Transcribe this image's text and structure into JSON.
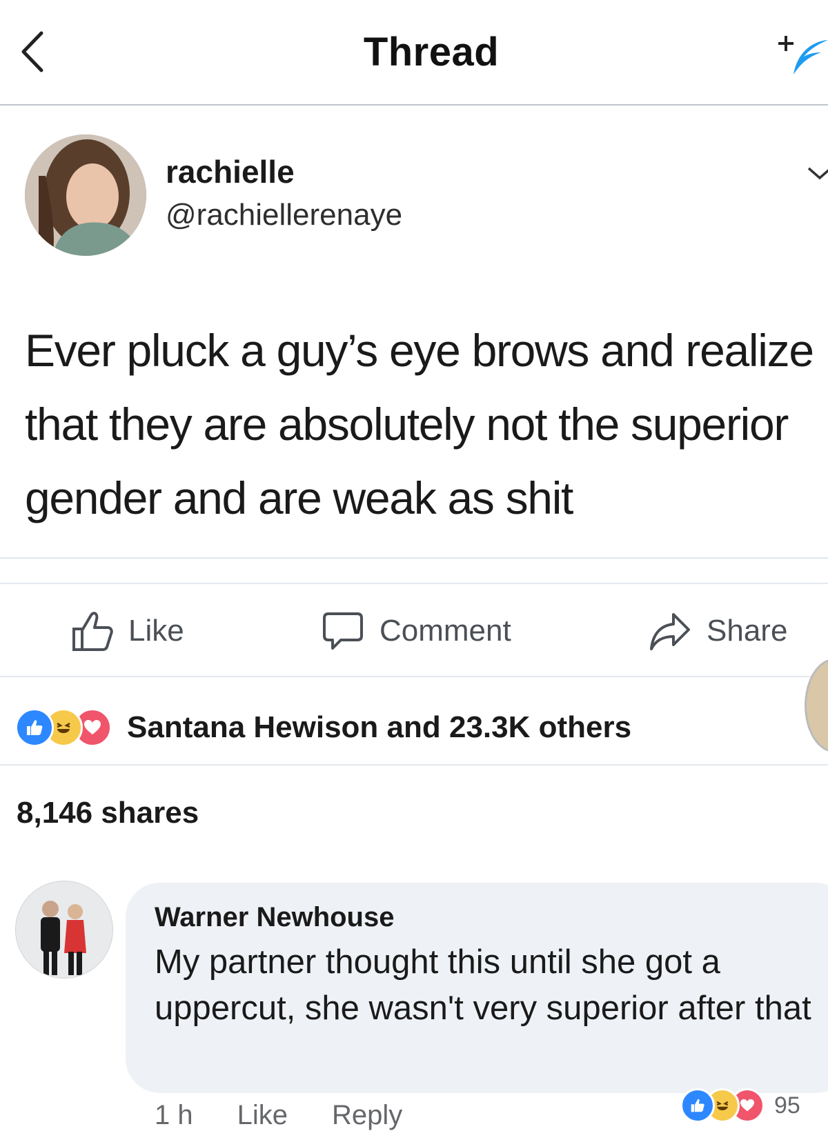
{
  "header": {
    "title": "Thread"
  },
  "post": {
    "author_name": "rachielle",
    "author_handle": "@rachiellerenaye",
    "text": "Ever pluck a guy’s eye brows and realize that they are absolutely not the superior gender and are weak as shit"
  },
  "actions": {
    "like_label": "Like",
    "comment_label": "Comment",
    "share_label": "Share"
  },
  "reactions": {
    "icons": [
      "like",
      "haha",
      "love"
    ],
    "summary": "Santana Hewison and 23.3K others"
  },
  "shares_count": "8,146 shares",
  "comment": {
    "author": "Warner Newhouse",
    "text": "My partner thought this until she got a uppercut, she wasn't very superior after that",
    "time": "1 h",
    "like_label": "Like",
    "reply_label": "Reply",
    "reaction_count": "95"
  },
  "colors": {
    "like_blue": "#2d88ff",
    "haha_yellow": "#f7c94a",
    "love_red": "#f0556b",
    "muted_text": "#65676b"
  }
}
